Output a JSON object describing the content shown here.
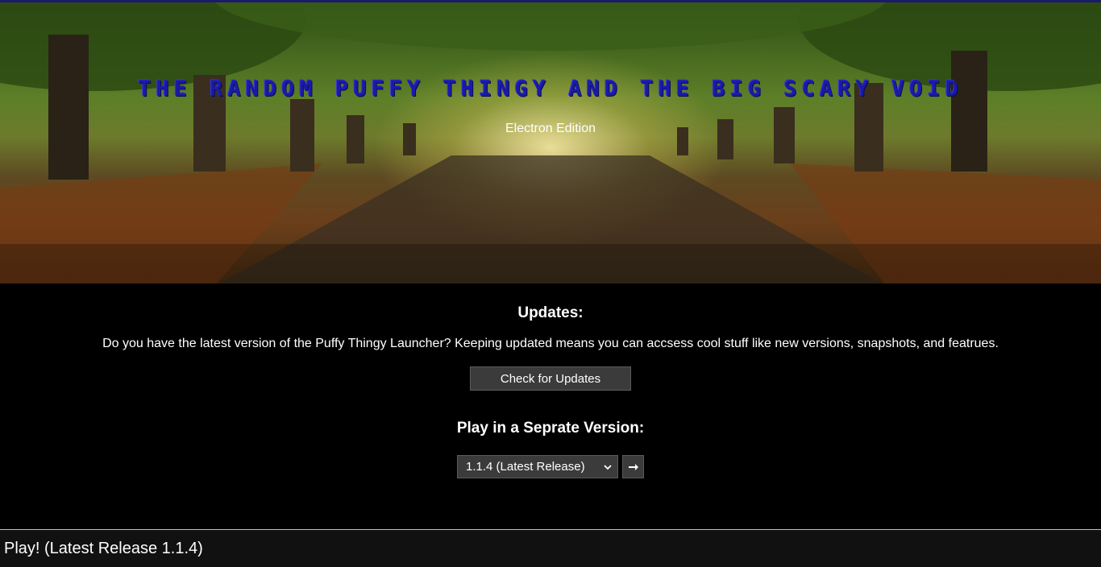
{
  "hero": {
    "title": "THE RANDOM PUFFY THINGY AND THE BIG SCARY VOID",
    "subtitle": "Electron Edition"
  },
  "updates": {
    "heading": "Updates:",
    "text": "Do you have the latest version of the Puffy Thingy Launcher? Keeping updated means you can accsess cool stuff like new versions, snapshots, and featrues.",
    "check_button": "Check for Updates"
  },
  "version": {
    "heading": "Play in a Seprate Version:",
    "selected": "1.1.4 (Latest Release)",
    "go_icon": "arrow-right-icon"
  },
  "play": {
    "label": "Play! (Latest Release 1.1.4)"
  },
  "colors": {
    "title": "#1a1aa8",
    "background": "#000000",
    "button": "#3b3b3b",
    "play_bar": "#111111"
  }
}
